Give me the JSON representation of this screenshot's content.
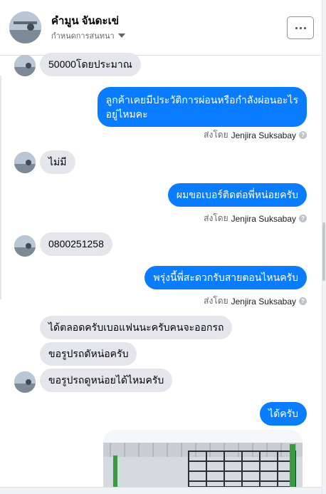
{
  "header": {
    "contact_name": "คำมูน จันดะเข่",
    "subtitle": "กำหนดการสนทนา",
    "more_label": "more-options"
  },
  "messages": [
    {
      "side": "in",
      "text": "50000โดยประมาณ"
    },
    {
      "side": "out",
      "lines": [
        "ลูกค้าเคยมีประวัติการผ่อนหรือกำลังผ่อนอะไร",
        "อยู่ไหมคะ"
      ],
      "sent_prefix": "ส่งโดย",
      "sent_by": "Jenjira Suksabay"
    },
    {
      "side": "in",
      "text": "ไม่มี"
    },
    {
      "side": "out",
      "text": "ผมขอเบอร์ติดต่อพี่หน่อยครับ",
      "sent_prefix": "ส่งโดย",
      "sent_by": "Jenjira Suksabay"
    },
    {
      "side": "in",
      "text": "0800251258"
    },
    {
      "side": "out",
      "text": "พรุ่งนี้พี่สะดวกรับสายตอนไหนครับ",
      "sent_prefix": "ส่งโดย",
      "sent_by": "Jenjira Suksabay"
    },
    {
      "side": "in",
      "text": "ได้ตลอดครับเบอแฟนนะครับคนจะออกรถ"
    },
    {
      "side": "in",
      "text": "ขอรูปรถดัหน่อครับ"
    },
    {
      "side": "in",
      "text": "ขอรูปรถดูหน่อยได้ไหมครับ"
    },
    {
      "side": "out",
      "text": "ได้ครับ"
    }
  ],
  "colors": {
    "outgoing_bubble": "#0a7cff",
    "incoming_bubble": "#e4e6eb"
  }
}
